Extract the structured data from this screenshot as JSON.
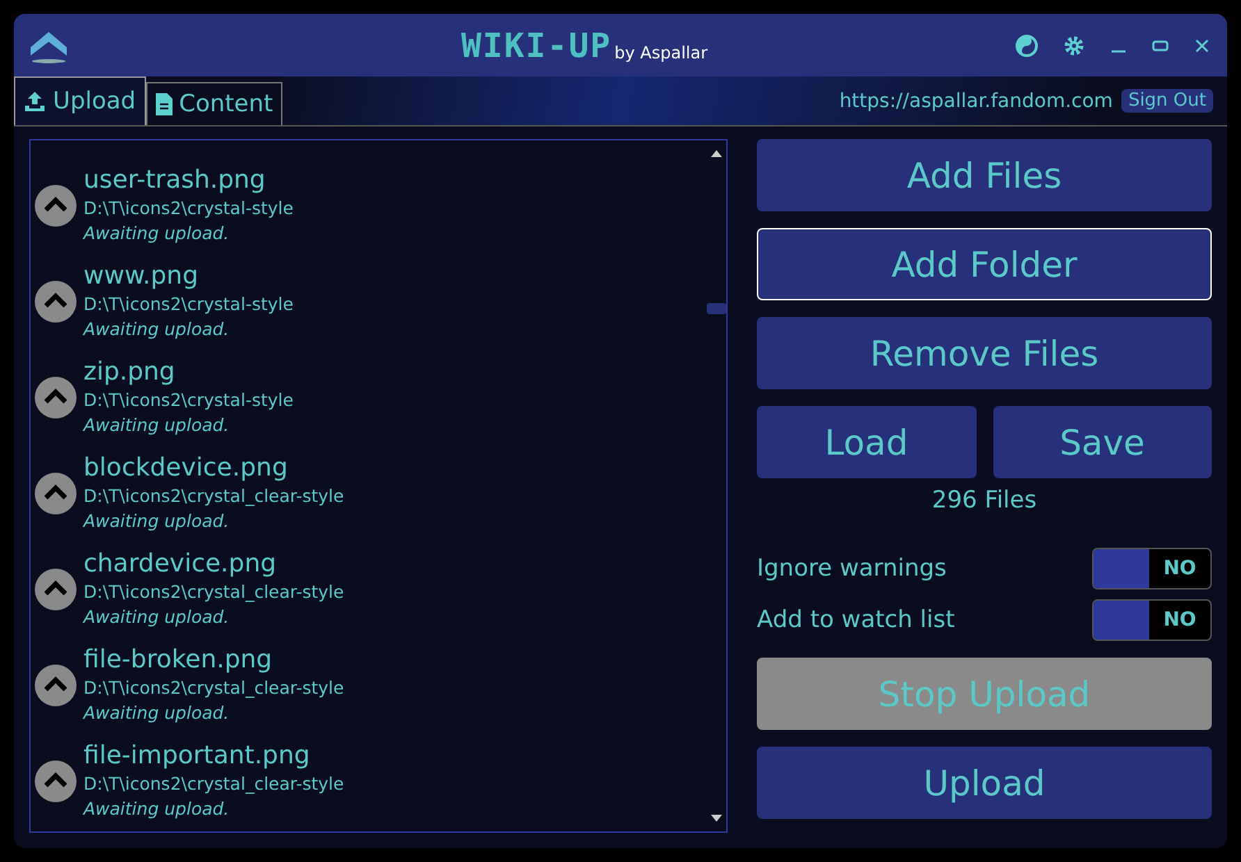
{
  "window": {
    "title": "WIKI-UP",
    "subtitle": "by Aspallar"
  },
  "tabs": [
    {
      "label": "Upload",
      "selected": true
    },
    {
      "label": "Content",
      "selected": false
    }
  ],
  "site": {
    "url": "https://aspallar.fandom.com",
    "sign_out": "Sign Out"
  },
  "files": [
    {
      "name": "user-trash.png",
      "path": "D:\\T\\icons2\\crystal-style",
      "status": "Awaiting upload."
    },
    {
      "name": "www.png",
      "path": "D:\\T\\icons2\\crystal-style",
      "status": "Awaiting upload."
    },
    {
      "name": "zip.png",
      "path": "D:\\T\\icons2\\crystal-style",
      "status": "Awaiting upload."
    },
    {
      "name": "blockdevice.png",
      "path": "D:\\T\\icons2\\crystal_clear-style",
      "status": "Awaiting upload."
    },
    {
      "name": "chardevice.png",
      "path": "D:\\T\\icons2\\crystal_clear-style",
      "status": "Awaiting upload."
    },
    {
      "name": "file-broken.png",
      "path": "D:\\T\\icons2\\crystal_clear-style",
      "status": "Awaiting upload."
    },
    {
      "name": "file-important.png",
      "path": "D:\\T\\icons2\\crystal_clear-style",
      "status": "Awaiting upload."
    }
  ],
  "buttons": [
    {
      "label": "Add Files",
      "focused": false
    },
    {
      "label": "Add Folder",
      "focused": true
    },
    {
      "label": "Remove Files",
      "focused": false
    }
  ],
  "load_save": [
    {
      "label": "Load"
    },
    {
      "label": "Save"
    }
  ],
  "file_count": "296 Files",
  "options": [
    {
      "label": "Ignore warnings",
      "on": false,
      "state_text": "NO"
    },
    {
      "label": "Add to watch list",
      "on": false,
      "state_text": "NO"
    }
  ],
  "stop_upload": {
    "label": "Stop Upload",
    "disabled": true
  },
  "upload": {
    "label": "Upload",
    "disabled": false
  }
}
